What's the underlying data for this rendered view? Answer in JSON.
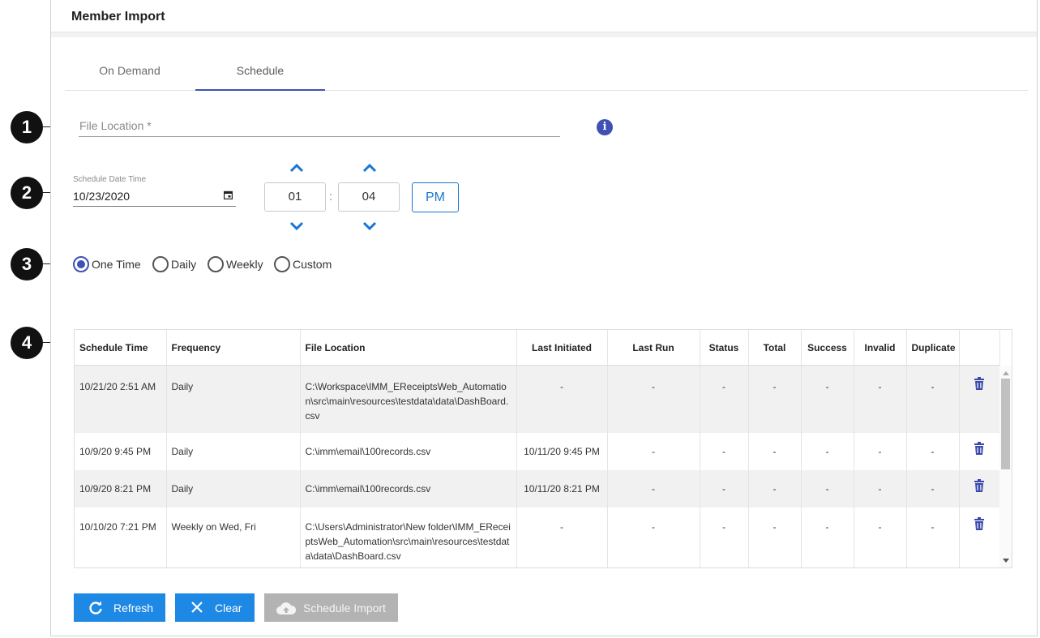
{
  "panel": {
    "title": "Member Import"
  },
  "tabs": [
    {
      "label": "On Demand",
      "active": false
    },
    {
      "label": "Schedule",
      "active": true
    }
  ],
  "callouts": [
    "1",
    "2",
    "3",
    "4"
  ],
  "file_location": {
    "placeholder": "File Location *",
    "info_icon": "info-icon"
  },
  "schedule": {
    "date_label": "Schedule Date Time",
    "date_value": "10/23/2020",
    "hour": "01",
    "minute": "04",
    "separator": ":",
    "ampm": "PM"
  },
  "frequency_options": [
    {
      "label": "One Time",
      "checked": true
    },
    {
      "label": "Daily",
      "checked": false
    },
    {
      "label": "Weekly",
      "checked": false
    },
    {
      "label": "Custom",
      "checked": false
    }
  ],
  "table": {
    "headers": [
      "Schedule Time",
      "Frequency",
      "File Location",
      "Last Initiated",
      "Last Run",
      "Status",
      "Total",
      "Success",
      "Invalid",
      "Duplicate"
    ],
    "rows": [
      {
        "schedule_time": "10/21/20 2:51 AM",
        "frequency": "Daily",
        "file_location": "C:\\Workspace\\IMM_EReceiptsWeb_Automation\\src\\main\\resources\\testdata\\data\\DashBoard.csv",
        "last_initiated": "-",
        "last_run": "-",
        "status": "-",
        "total": "-",
        "success": "-",
        "invalid": "-",
        "duplicate": "-"
      },
      {
        "schedule_time": "10/9/20 9:45 PM",
        "frequency": "Daily",
        "file_location": "C:\\imm\\email\\100records.csv",
        "last_initiated": "10/11/20 9:45 PM",
        "last_run": "-",
        "status": "-",
        "total": "-",
        "success": "-",
        "invalid": "-",
        "duplicate": "-"
      },
      {
        "schedule_time": "10/9/20 8:21 PM",
        "frequency": "Daily",
        "file_location": "C:\\imm\\email\\100records.csv",
        "last_initiated": "10/11/20 8:21 PM",
        "last_run": "-",
        "status": "-",
        "total": "-",
        "success": "-",
        "invalid": "-",
        "duplicate": "-"
      },
      {
        "schedule_time": "10/10/20 7:21 PM",
        "frequency": "Weekly on Wed, Fri",
        "file_location": "C:\\Users\\Administrator\\New folder\\IMM_EReceiptsWeb_Automation\\src\\main\\resources\\testdata\\data\\DashBoard.csv",
        "last_initiated": "-",
        "last_run": "-",
        "status": "-",
        "total": "-",
        "success": "-",
        "invalid": "-",
        "duplicate": "-"
      }
    ]
  },
  "buttons": {
    "refresh": "Refresh",
    "clear": "Clear",
    "schedule_import": "Schedule Import"
  },
  "colors": {
    "accent": "#3f51b5",
    "button_blue": "#1e88e5",
    "disabled": "#b3b3b3"
  }
}
